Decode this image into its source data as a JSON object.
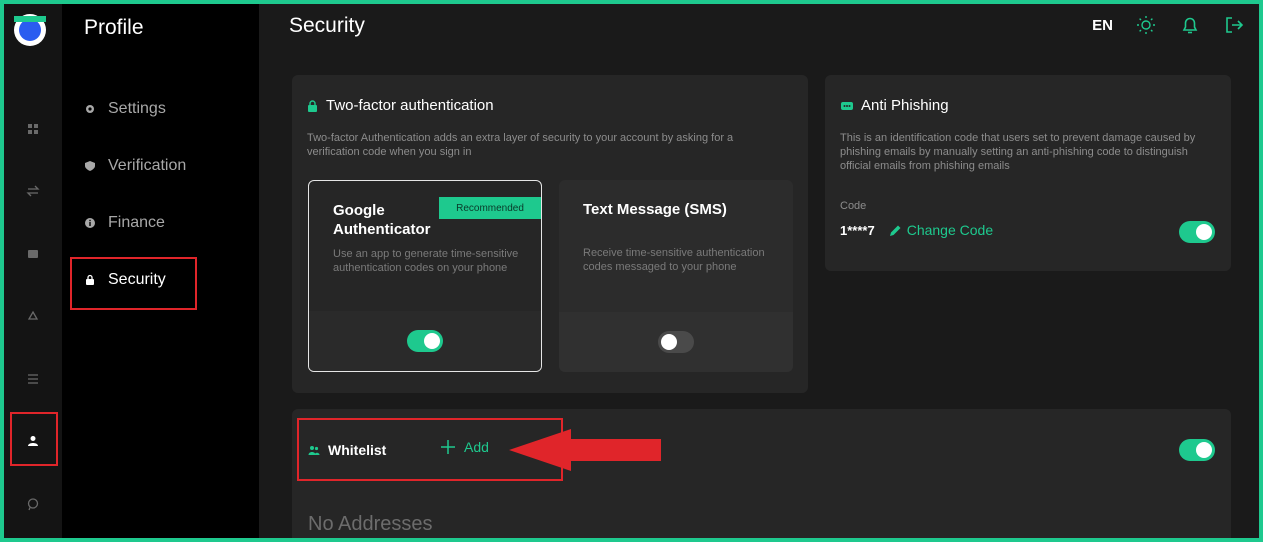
{
  "nav": {
    "icons": [
      "grid-icon",
      "transfer-icon",
      "wallet-icon",
      "recycle-icon",
      "list-icon",
      "user-icon",
      "chat-icon"
    ]
  },
  "sidebar": {
    "title": "Profile",
    "items": [
      {
        "label": "Settings",
        "icon": "gear-icon"
      },
      {
        "label": "Verification",
        "icon": "shield-icon"
      },
      {
        "label": "Finance",
        "icon": "info-icon"
      },
      {
        "label": "Security",
        "icon": "lock-icon",
        "active": true
      }
    ]
  },
  "header": {
    "title": "Security",
    "lang": "EN"
  },
  "two_factor": {
    "title": "Two-factor authentication",
    "description": "Two-factor Authentication adds an extra layer of security to your account by asking for a verification code when you sign in",
    "options": [
      {
        "title": "Google Authenticator",
        "badge": "Recommended",
        "description": "Use an app to generate time-sensitive authentication codes on your phone",
        "enabled": true
      },
      {
        "title": "Text Message (SMS)",
        "description": "Receive time-sensitive authentication codes messaged to your phone",
        "enabled": false
      }
    ]
  },
  "anti_phishing": {
    "title": "Anti Phishing",
    "description": "This is an identification code that users set to prevent damage caused by phishing emails by manually setting an anti-phishing code to distinguish official emails from phishing emails",
    "code_label": "Code",
    "code_value": "1****7",
    "change_label": "Change Code",
    "enabled": true
  },
  "whitelist": {
    "title": "Whitelist",
    "add_label": "Add",
    "empty_text": "No Addresses",
    "enabled": true
  },
  "colors": {
    "accent": "#1ec98e",
    "highlight": "#e0252a",
    "background": "#1a1a1a",
    "card": "#262626"
  }
}
